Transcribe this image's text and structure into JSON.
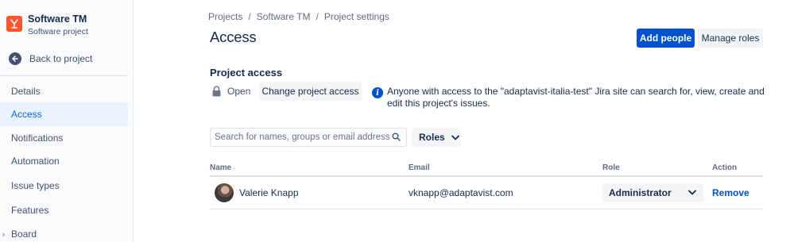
{
  "project": {
    "name": "Software TM",
    "type": "Software project"
  },
  "sidebar": {
    "back_label": "Back to project",
    "items": [
      {
        "label": "Details",
        "active": false
      },
      {
        "label": "Access",
        "active": true
      },
      {
        "label": "Notifications",
        "active": false
      },
      {
        "label": "Automation",
        "active": false
      },
      {
        "label": "Issue types",
        "active": false
      },
      {
        "label": "Features",
        "active": false
      },
      {
        "label": "Board",
        "active": false,
        "expandable": true
      }
    ]
  },
  "breadcrumb": [
    "Projects",
    "Software TM",
    "Project settings"
  ],
  "header": {
    "title": "Access",
    "add_people_label": "Add people",
    "manage_roles_label": "Manage roles"
  },
  "project_access": {
    "title": "Project access",
    "status": "Open",
    "change_button_label": "Change project access",
    "info_text": "Anyone with access to the \"adaptavist-italia-test\" Jira site can search for, view, create and edit this project's issues."
  },
  "filters": {
    "search_placeholder": "Search for names, groups or email addresses",
    "search_value": "",
    "roles_label": "Roles"
  },
  "table": {
    "columns": [
      "Name",
      "Email",
      "Role",
      "Action"
    ],
    "rows": [
      {
        "name": "Valerie Knapp",
        "email": "vknapp@adaptavist.com",
        "role": "Administrator",
        "action": "Remove"
      }
    ]
  },
  "colors": {
    "primary": "#0052cc",
    "active_nav_bg": "#e9f2ff",
    "active_nav_text": "#0c66e4",
    "project_avatar": "#ff5630",
    "text": "#172b4d"
  },
  "icons": {
    "project_avatar": "project-rocket-icon",
    "back": "arrow-left-icon",
    "lock": "lock-icon",
    "info": "info-icon",
    "search": "search-icon",
    "chevron": "chevron-down-icon",
    "expand": "chevron-right-icon"
  }
}
